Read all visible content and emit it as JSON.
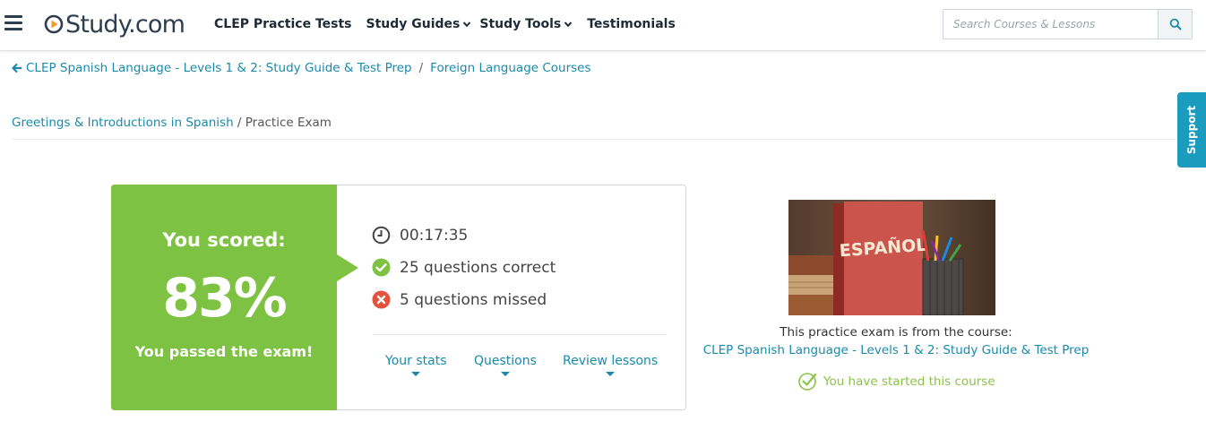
{
  "header": {
    "logo_text": "Study.com",
    "nav": [
      {
        "label": "CLEP Practice Tests",
        "dropdown": false
      },
      {
        "label": "Study Guides",
        "dropdown": true
      },
      {
        "label": "Study Tools",
        "dropdown": true
      },
      {
        "label": "Testimonials",
        "dropdown": false
      }
    ],
    "search_placeholder": "Search Courses & Lessons"
  },
  "breadcrumb": {
    "course": "CLEP Spanish Language - Levels 1 & 2: Study Guide & Test Prep",
    "separator": "/",
    "category": "Foreign Language Courses"
  },
  "sub_breadcrumb": {
    "chapter": "Greetings & Introductions in Spanish",
    "current": " / Practice Exam"
  },
  "support_tab": "Support",
  "result": {
    "score_label": "You scored:",
    "score_value": "83%",
    "pass_message": "You passed the exam!",
    "time": "00:17:35",
    "correct": "25 questions correct",
    "missed": "5 questions missed",
    "tabs": [
      "Your stats",
      "Questions",
      "Review lessons"
    ]
  },
  "course_panel": {
    "image_text": "ESPAÑOL",
    "note": "This practice exam is from the course:",
    "course_link": "CLEP Spanish Language - Levels 1 & 2: Study Guide & Test Prep",
    "started": "You have started this course"
  },
  "colors": {
    "brand_dark": "#2d3e4f",
    "accent_teal": "#1b8aaa",
    "success_green": "#7dc242",
    "error_red": "#e0533c",
    "support_blue": "#1b9bbd"
  }
}
